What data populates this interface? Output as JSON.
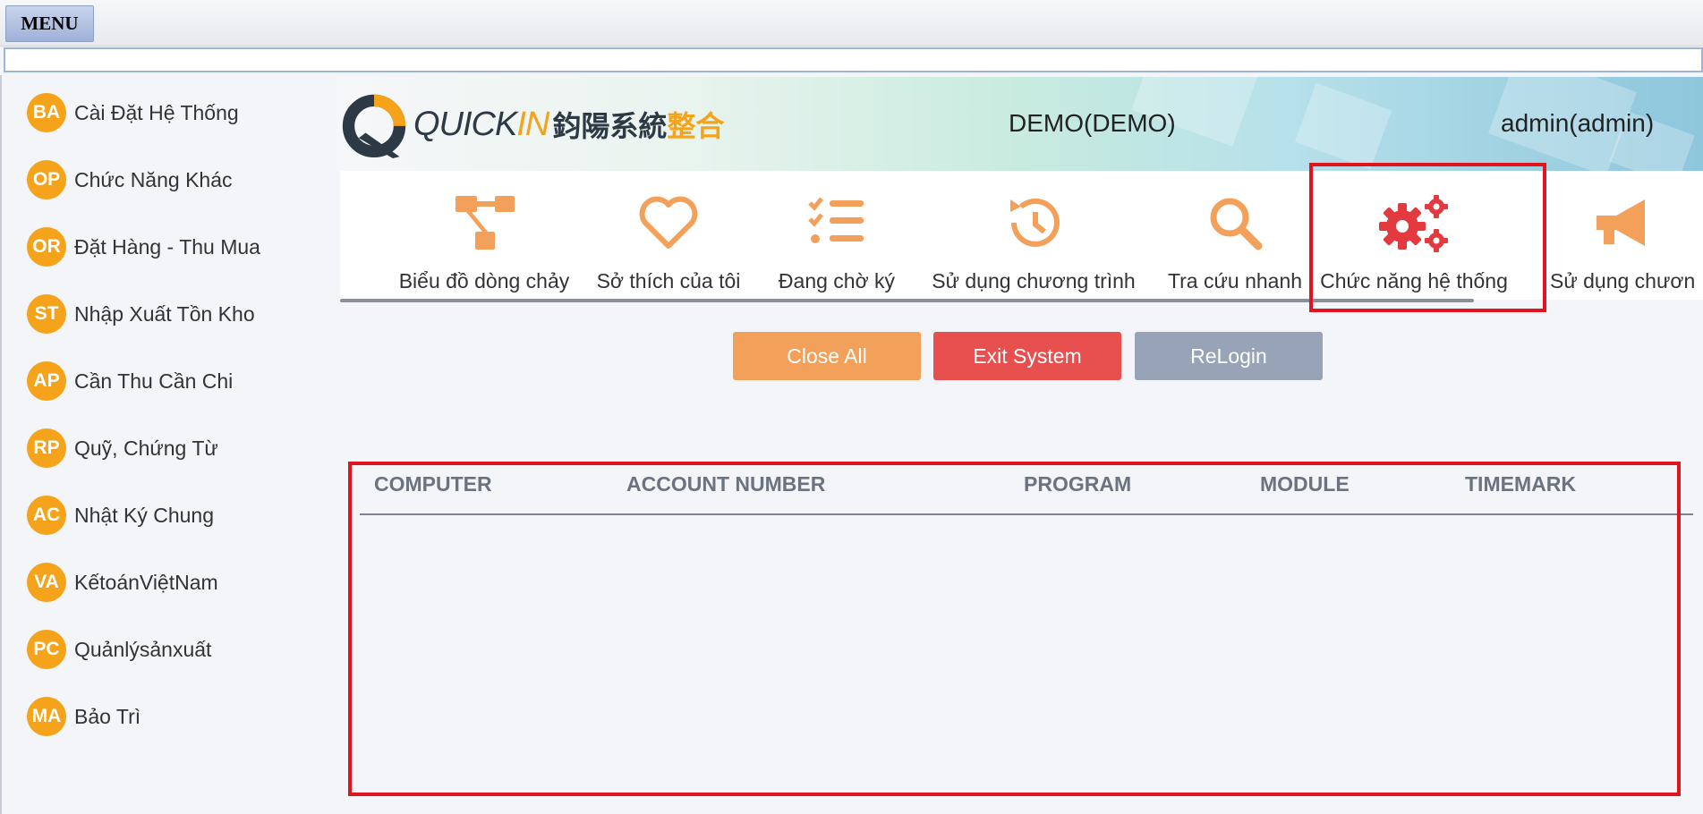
{
  "menu": {
    "label": "MENU"
  },
  "sidebar": {
    "items": [
      {
        "code": "BA",
        "label": "Cài Đặt Hệ Thống"
      },
      {
        "code": "OP",
        "label": "Chức Năng Khác"
      },
      {
        "code": "OR",
        "label": "Đặt Hàng - Thu Mua"
      },
      {
        "code": "ST",
        "label": "Nhập Xuất Tồn Kho"
      },
      {
        "code": "AP",
        "label": "Cần Thu Cần Chi"
      },
      {
        "code": "RP",
        "label": "Quỹ, Chứng Từ"
      },
      {
        "code": "AC",
        "label": "Nhật Ký Chung"
      },
      {
        "code": "VA",
        "label": "KếtoánViệtNam"
      },
      {
        "code": "PC",
        "label": "Quảnlýsảnxuất"
      },
      {
        "code": "MA",
        "label": "Bảo Trì"
      }
    ]
  },
  "header": {
    "logo_latin": "QUICK",
    "logo_latin_accent": "IN",
    "logo_cjk": "鈞陽系統",
    "logo_cjk_accent": "整合",
    "company": "DEMO(DEMO)",
    "user": "admin(admin)"
  },
  "toolbar": {
    "items": [
      {
        "label": "Biểu đồ dòng chảy",
        "icon": "flowchart-icon"
      },
      {
        "label": "Sở thích của tôi",
        "icon": "heart-icon"
      },
      {
        "label": "Đang chờ ký",
        "icon": "checklist-icon"
      },
      {
        "label": "Sử dụng chương trình",
        "icon": "history-icon"
      },
      {
        "label": "Tra cứu nhanh",
        "icon": "search-icon"
      },
      {
        "label": "Chức năng hệ thống",
        "icon": "gears-icon"
      },
      {
        "label": "Sử dụng chươn",
        "icon": "megaphone-icon"
      }
    ]
  },
  "actions": {
    "close_all": "Close All",
    "exit_system": "Exit System",
    "relogin": "ReLogin"
  },
  "table": {
    "columns": [
      "COMPUTER",
      "ACCOUNT NUMBER",
      "PROGRAM",
      "MODULE",
      "TIMEMARK"
    ],
    "rows": []
  },
  "colors": {
    "accent": "#f5a31a",
    "highlight": "#e0141e",
    "exit": "#e85050",
    "close": "#f2a05a",
    "relogin": "#97a3b6"
  }
}
